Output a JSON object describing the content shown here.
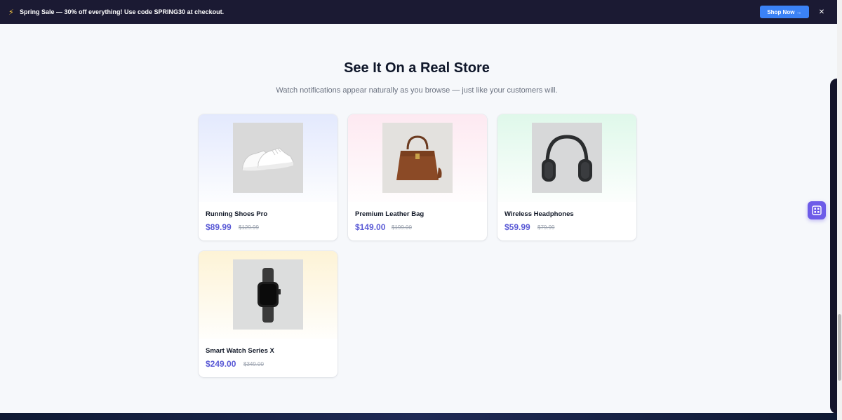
{
  "banner": {
    "icon": "sparkle-icon",
    "text": "Spring Sale — 30% off everything! Use code SPRING30 at checkout.",
    "button_label": "Shop Now →",
    "close_label": "✕"
  },
  "section": {
    "title": "See It On a Real Store",
    "subtitle": "Watch notifications appear naturally as you browse — just like your customers will."
  },
  "products": [
    {
      "name": "Running Shoes Pro",
      "price": "$89.99",
      "old_price": "$129.99",
      "bg": "#e3e9fd",
      "image": "sneakers-image"
    },
    {
      "name": "Premium Leather Bag",
      "price": "$149.00",
      "old_price": "$199.00",
      "bg": "#fde9f1",
      "image": "leather-bag-image"
    },
    {
      "name": "Wireless Headphones",
      "price": "$59.99",
      "old_price": "$79.99",
      "bg": "#dff8ea",
      "image": "headphones-image"
    },
    {
      "name": "Smart Watch Series X",
      "price": "$249.00",
      "old_price": "$349.00",
      "bg": "#fdf3d6",
      "image": "smartwatch-image"
    }
  ],
  "colors": {
    "accent": "#5b5bd6",
    "banner_bg": "#1b1a33",
    "button_bg": "#3b82f6",
    "widget_bg": "#6d5ce8"
  },
  "widget": {
    "icon": "grid-icon"
  }
}
